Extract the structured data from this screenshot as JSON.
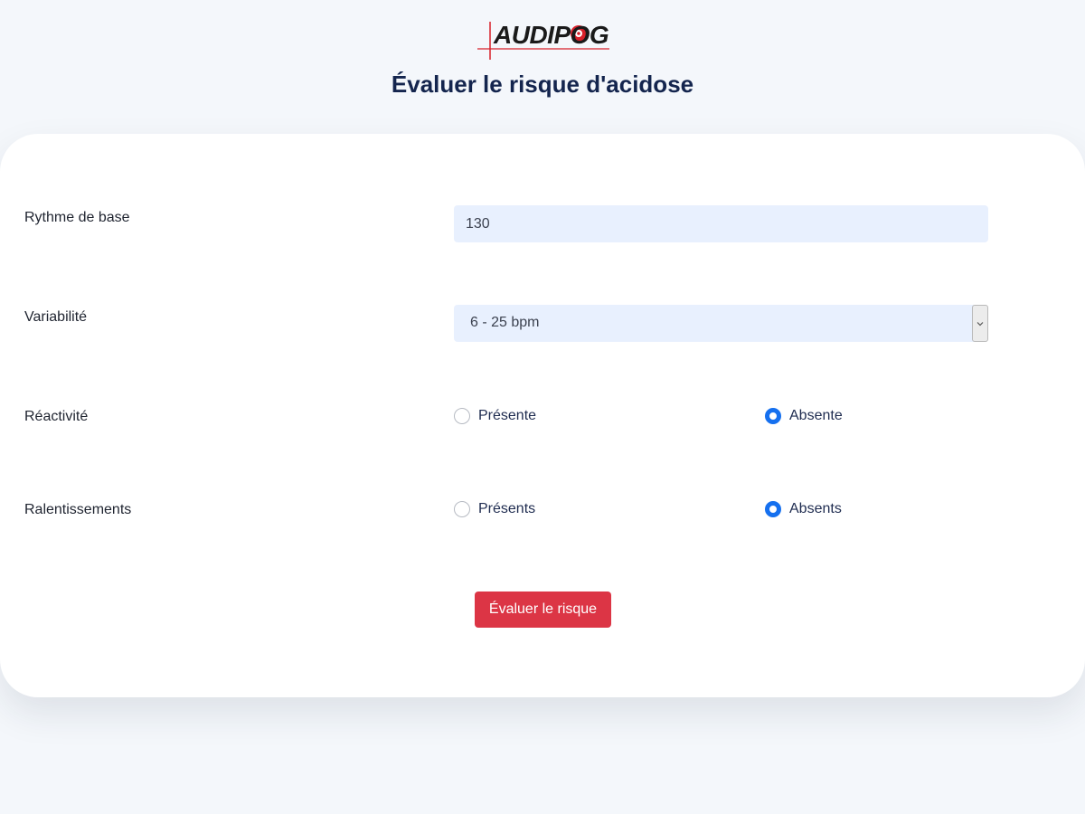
{
  "header": {
    "logo_text": "AUDIPOG",
    "title": "Évaluer le risque d'acidose"
  },
  "form": {
    "rythme": {
      "label": "Rythme de base",
      "value": "130"
    },
    "variabilite": {
      "label": "Variabilité",
      "selected": "6 - 25 bpm"
    },
    "reactivite": {
      "label": "Réactivité",
      "options": [
        {
          "label": "Présente",
          "checked": false
        },
        {
          "label": "Absente",
          "checked": true
        }
      ]
    },
    "ralentissements": {
      "label": "Ralentissements",
      "options": [
        {
          "label": "Présents",
          "checked": false
        },
        {
          "label": "Absents",
          "checked": true
        }
      ]
    },
    "submit_label": "Évaluer le risque"
  },
  "colors": {
    "accent": "#dc3545",
    "radio_checked": "#1570ef",
    "title": "#14254e",
    "input_bg": "#e8f0fe"
  }
}
